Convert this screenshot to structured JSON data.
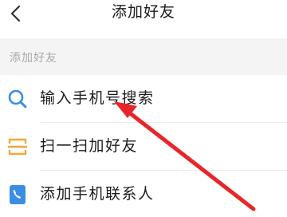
{
  "header": {
    "title": "添加好友",
    "back_icon": "chevron-left-icon"
  },
  "section": {
    "label": "添加好友"
  },
  "options": [
    {
      "label": "输入手机号搜索",
      "icon": "search-icon",
      "icon_color": "#3a8ee6"
    },
    {
      "label": "扫一扫加好友",
      "icon": "scan-icon",
      "icon_color": "#f2a83b"
    },
    {
      "label": "添加手机联系人",
      "icon": "phone-contact-icon",
      "icon_color": "#3a8ee6"
    }
  ],
  "annotation": {
    "arrow_color": "#e8262a",
    "points_to": "输入手机号搜索"
  }
}
